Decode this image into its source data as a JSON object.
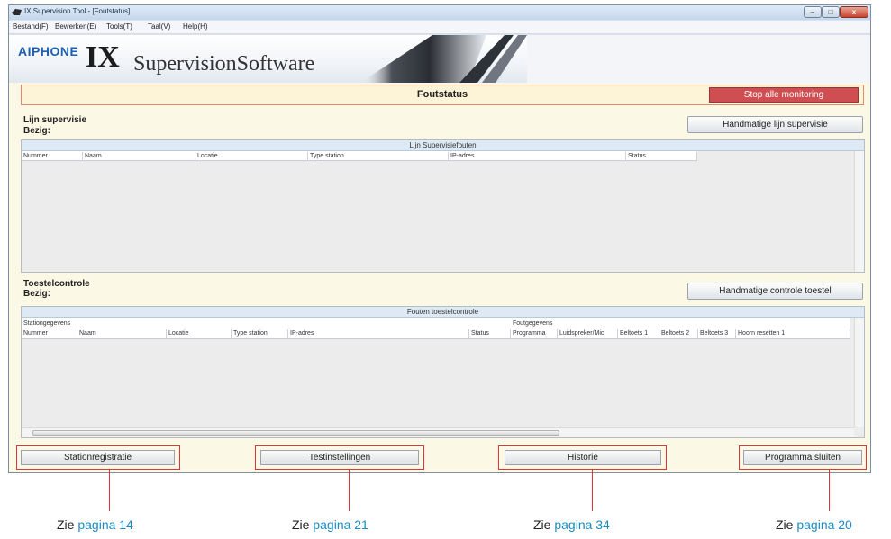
{
  "window": {
    "title": "IX Supervision Tool - [Foutstatus]",
    "controls": {
      "minimize": "–",
      "maximize": "□",
      "close": "x"
    }
  },
  "menu": [
    "Bestand(F)",
    "Bewerken(E)",
    "Tools(T)",
    "Taal(V)",
    "Help(H)"
  ],
  "banner": {
    "brand": "AIPHONE",
    "product_prefix": "IX",
    "product_name": "SupervisionSoftware"
  },
  "status": {
    "title": "Foutstatus",
    "stop_button": "Stop alle monitoring"
  },
  "line_supervision": {
    "title": "Lijn supervisie",
    "busy_label": "Bezig:",
    "button": "Handmatige lijn supervisie",
    "grid_caption": "Lijn Supervisiefouten",
    "columns": [
      "Nummer",
      "Naam",
      "Locatie",
      "Type station",
      "IP-adres",
      "Status"
    ]
  },
  "device_check": {
    "title": "Toestelcontrole",
    "busy_label": "Bezig:",
    "button": "Handmatige controle toestel",
    "grid_caption": "Fouten toestelcontrole",
    "group_station": "Stationgegevens",
    "group_fault": "Foutgegevens",
    "columns": [
      "Nummer",
      "Naam",
      "Locatie",
      "Type station",
      "IP-adres",
      "Status",
      "Programma",
      "Luidspreker/Mic",
      "Beltoets 1",
      "Beltoets 2",
      "Beltoets 3",
      "Hoorn resetten 1"
    ]
  },
  "bottom_buttons": [
    "Stationregistratie",
    "Testinstellingen",
    "Historie",
    "Programma sluiten"
  ],
  "references": [
    {
      "prefix": "Zie ",
      "link": "pagina 14"
    },
    {
      "prefix": "Zie ",
      "link": "pagina 21"
    },
    {
      "prefix": "Zie ",
      "link": "pagina 34"
    },
    {
      "prefix": "Zie ",
      "link": "pagina 20"
    }
  ],
  "colors": {
    "stop": "#cf4e52",
    "frame": "#d8363a",
    "link": "#1a8cc2",
    "brand": "#1d5fb0"
  }
}
